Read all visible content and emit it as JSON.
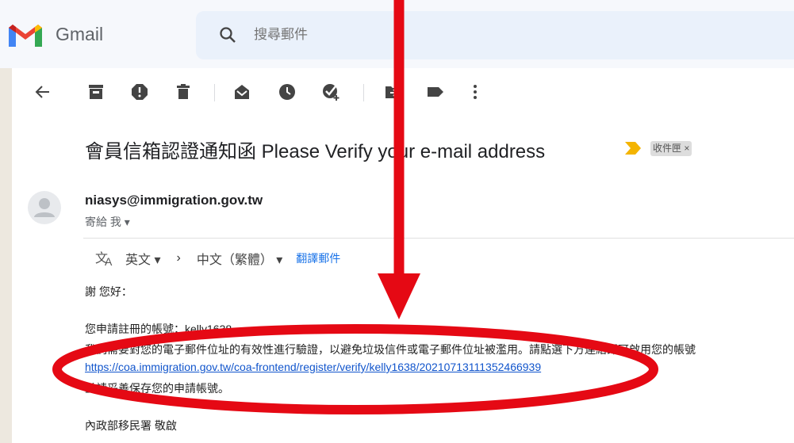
{
  "app": {
    "brand": "Gmail"
  },
  "search": {
    "placeholder": "搜尋郵件"
  },
  "email": {
    "subject": "會員信箱認證通知函 Please Verify your e-mail address",
    "label": "收件匣 ×",
    "sender": "niasys@immigration.gov.tw",
    "recipient": "寄給 我 ▾",
    "translate": {
      "from": "英文 ▾",
      "arrow": "›",
      "to": "中文（繁體） ▾",
      "link": "翻譯郵件"
    },
    "greeting": "謝 您好：",
    "account_line": "您申請註冊的帳號：kelly1638",
    "verify_line": "我們需要對您的電子郵件位址的有效性進行驗證，以避免垃圾信件或電子郵件位址被濫用。請點選下方連結即可啟用您的帳號",
    "verify_url": "https://coa.immigration.gov.tw/coa-frontend/register/verify/kelly1638/20210713111352466939",
    "save_line": "並請妥善保存您的申請帳號。",
    "signature": "內政部移民署 敬啟"
  },
  "colors": {
    "annotation_red": "#e50914",
    "accent": "#1a73e8"
  }
}
